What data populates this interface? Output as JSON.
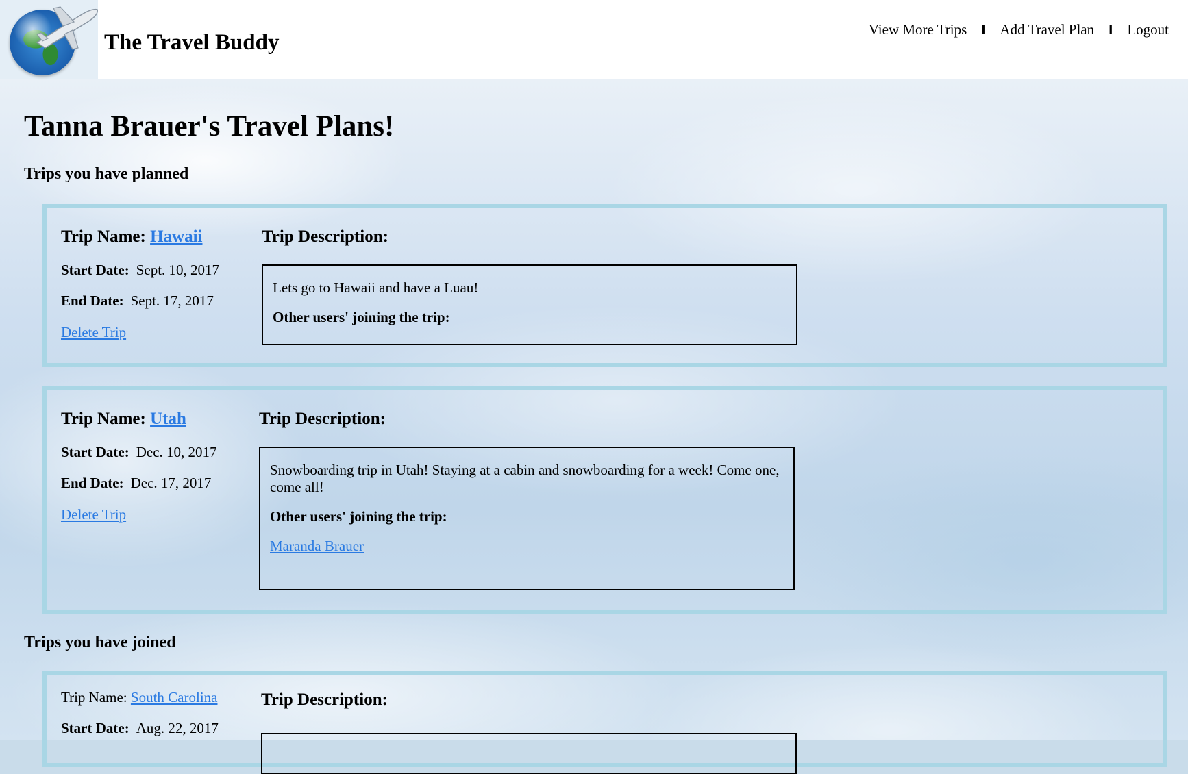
{
  "header": {
    "site_title": "The Travel Buddy",
    "nav": {
      "view_more": "View More Trips",
      "separator": "I",
      "add_plan": "Add Travel Plan",
      "logout": "Logout"
    }
  },
  "page": {
    "title": "Tanna Brauer's Travel Plans!",
    "planned_heading": "Trips you have planned",
    "joined_heading": "Trips you have joined"
  },
  "labels": {
    "trip_name": "Trip Name:",
    "start_date": "Start Date:",
    "end_date": "End Date:",
    "delete_trip": "Delete Trip",
    "trip_description": "Trip Description:",
    "other_users": "Other users' joining the trip:"
  },
  "planned_trips": [
    {
      "name": "Hawaii",
      "start_date": "Sept. 10, 2017",
      "end_date": "Sept. 17, 2017",
      "description": "Lets go to Hawaii and have a Luau!",
      "joiners": []
    },
    {
      "name": "Utah",
      "start_date": "Dec. 10, 2017",
      "end_date": "Dec. 17, 2017",
      "description": "Snowboarding trip in Utah! Staying at a cabin and snowboarding for a week! Come one, come all!",
      "joiners": [
        "Maranda Brauer"
      ]
    }
  ],
  "joined_trips": [
    {
      "name": "South Carolina",
      "start_date": "Aug. 22, 2017"
    }
  ],
  "colors": {
    "card_border": "#a9d6e5",
    "link": "#2a7ae2",
    "header_bg": "#ffffff"
  }
}
